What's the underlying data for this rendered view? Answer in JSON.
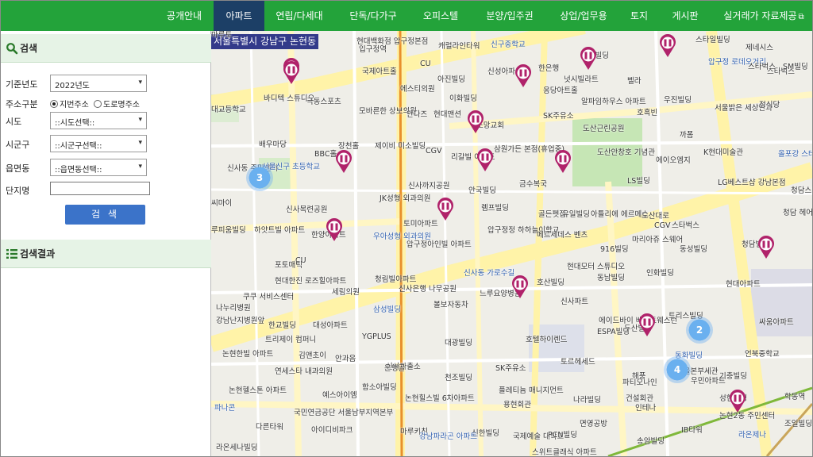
{
  "nav": {
    "tabs": [
      {
        "label": "공개안내",
        "active": false
      },
      {
        "label": "아파트",
        "active": true
      },
      {
        "label": "연립/다세대",
        "active": false
      },
      {
        "label": "단독/다가구",
        "active": false
      },
      {
        "label": "오피스텔",
        "active": false
      },
      {
        "label": "분양/입주권",
        "active": false
      },
      {
        "label": "상업/업무용",
        "active": false
      },
      {
        "label": "토지",
        "active": false
      },
      {
        "label": "게시판",
        "active": false
      },
      {
        "label": "실거래가 자료제공",
        "active": false,
        "icon": "external-link-icon"
      }
    ]
  },
  "search": {
    "title": "검색",
    "icon": "search-icon",
    "year_label": "기준년도",
    "year_value": "2022년도",
    "address_type_label": "주소구분",
    "address_options": [
      {
        "label": "지번주소",
        "checked": true
      },
      {
        "label": "도로명주소",
        "checked": false
      }
    ],
    "sido_label": "시도",
    "sido_value": "::시도선택::",
    "sigungu_label": "시군구",
    "sigungu_value": "::시군구선택::",
    "dong_label": "읍면동",
    "dong_value": "::읍면동선택::",
    "complex_label": "단지명",
    "complex_value": "",
    "button_label": "검 색"
  },
  "results": {
    "title": "검색결과",
    "icon": "list-icon"
  },
  "map": {
    "region": "서울특별시 강남구 논현동",
    "labels": [
      "현대백화점 압구정본점",
      "입구정역",
      "CU",
      "캐럴라인타워",
      "신구중학교",
      "임강빌딩",
      "스타일빌딩",
      "제네시스",
      "국제아트홀",
      "에스티의원",
      "아진빌딩",
      "신성아파트",
      "한은행",
      "넛시빌라트",
      "벨라",
      "대교등학교",
      "바디텍 스튜디오",
      "극동스포츠",
      "모바른한 상보의원",
      "안다즈",
      "현대맨션",
      "이화빌딩",
      "응당아트홀",
      "알파임하우스 아파트",
      "호흑빈",
      "우진빌딩",
      "서울밝은 세상안과",
      "정식당",
      "스타벅스",
      "압구정 로데오거리",
      "스타벅스",
      "SK주유소",
      "소망교회",
      "배우마당",
      "장천홀",
      "BBC홀",
      "제이비 미소빌딩",
      "CGV",
      "삼원가든 본점(휴업중)",
      "도산근린공원",
      "까폼",
      "K현대미술관",
      "신사동 주민센터",
      "서울신구 초등학교",
      "리갈빌 아파트",
      "도산안창호 기념관",
      "에이오엠지",
      "올포강 스테이크하우스",
      "LS빌딩",
      "LG베스트샵 강남본점",
      "청담스타",
      "씨마이",
      "JK성형 외과의원",
      "신사까지공원",
      "안국빌딩",
      "금수복국",
      "청담 헤어렌의원",
      "신사목련공원",
      "토미아파트",
      "렘프빌딩",
      "골든펫집",
      "유일빌딩",
      "아틀리에 에르메스",
      "CGV",
      "도산대로",
      "스타벅스",
      "루피움빌딩",
      "하얏트빌 아파트",
      "우아성형 외과의원",
      "압구정정 하하늘이학교",
      "메르세데스 벤츠",
      "마리아쥬 스웨어",
      "한양아파트",
      "압구정아인빌 아파트",
      "916빌딩",
      "동성빌딩",
      "청담빌딩",
      "CU",
      "포토매틱",
      "현대모터 스튜디오",
      "신사동 가로수길",
      "동남빌딩",
      "인화빌딩",
      "현대한진 로즈힐아파트",
      "청림빌아파트",
      "세림의원",
      "신사은행 나무공원",
      "느루요양병원",
      "호산빌딩",
      "현대아파트",
      "쿠쿠 서비스센터",
      "신사파트",
      "나누리병원",
      "삼성빌딩",
      "강남난지병원앞",
      "한교빌딩",
      "대성아파트",
      "볼보자동차",
      "에이드바이 베스트웨스턴",
      "트리스빌딩",
      "싸움아파트",
      "트리제이 컴퍼니",
      "YGPLUS",
      "대광빌딩",
      "ESPA빌딩",
      "두산빌딩",
      "동화빌딩",
      "논현한빌 아파트",
      "김앤초이",
      "안과음",
      "호텔하이렌드",
      "언북중학교",
      "연세스타 내과의원",
      "신사파출소",
      "SK주유소",
      "토르헤세드",
      "서울본부세관",
      "논현헬스톤 아파트",
      "은행골",
      "파티오나인",
      "해풍",
      "우민아파트",
      "기충빌딩",
      "예스아이엠",
      "함소아빌딩",
      "논현힐스빌 6차아파트",
      "천조빌딩",
      "플레티늄 매니지먼트",
      "나라빌딩",
      "건설회관",
      "성현빌딩",
      "파나콘",
      "국민연금공단 서울남부지역본부",
      "용현회관",
      "인테나",
      "논현2동 주민센터",
      "다른타워",
      "아이디비파크",
      "마루키친",
      "신한빌딩",
      "국제예술 대학교",
      "PCN빌딩",
      "면영공방",
      "송암빌딩",
      "IB타워",
      "라온제나",
      "강남파라곤 아파트",
      "스위트클래식 아파트",
      "조일빌딩",
      "학동역",
      "라온세나빌딩",
      "SM빌딩",
      "마루토"
    ],
    "clusters": [
      {
        "count": "3"
      },
      {
        "count": "2"
      },
      {
        "count": "4"
      }
    ]
  }
}
